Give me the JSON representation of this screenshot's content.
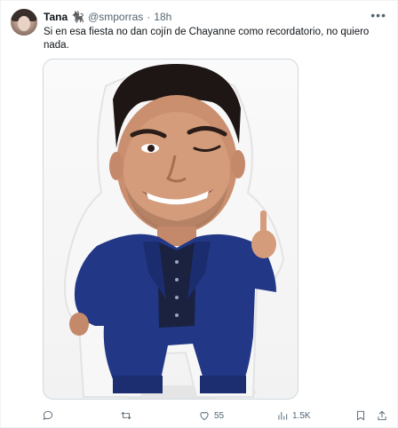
{
  "tweet": {
    "author_name": "Tana",
    "author_emoji": "🐈‍⬛",
    "handle": "@smporras",
    "separator": "·",
    "time": "18h",
    "text": "Si en esa fiesta no dan cojín de Chayanne como recordatorio, no quiero nada.",
    "media_icon_name": "photo-cushion-image",
    "actions": {
      "reply_icon": "reply-icon",
      "retweet_icon": "retweet-icon",
      "like_icon": "heart-icon",
      "like_count": "55",
      "views_icon": "views-chart-icon",
      "views_count": "1.5K",
      "bookmark_icon": "bookmark-icon",
      "share_icon": "share-icon"
    }
  }
}
